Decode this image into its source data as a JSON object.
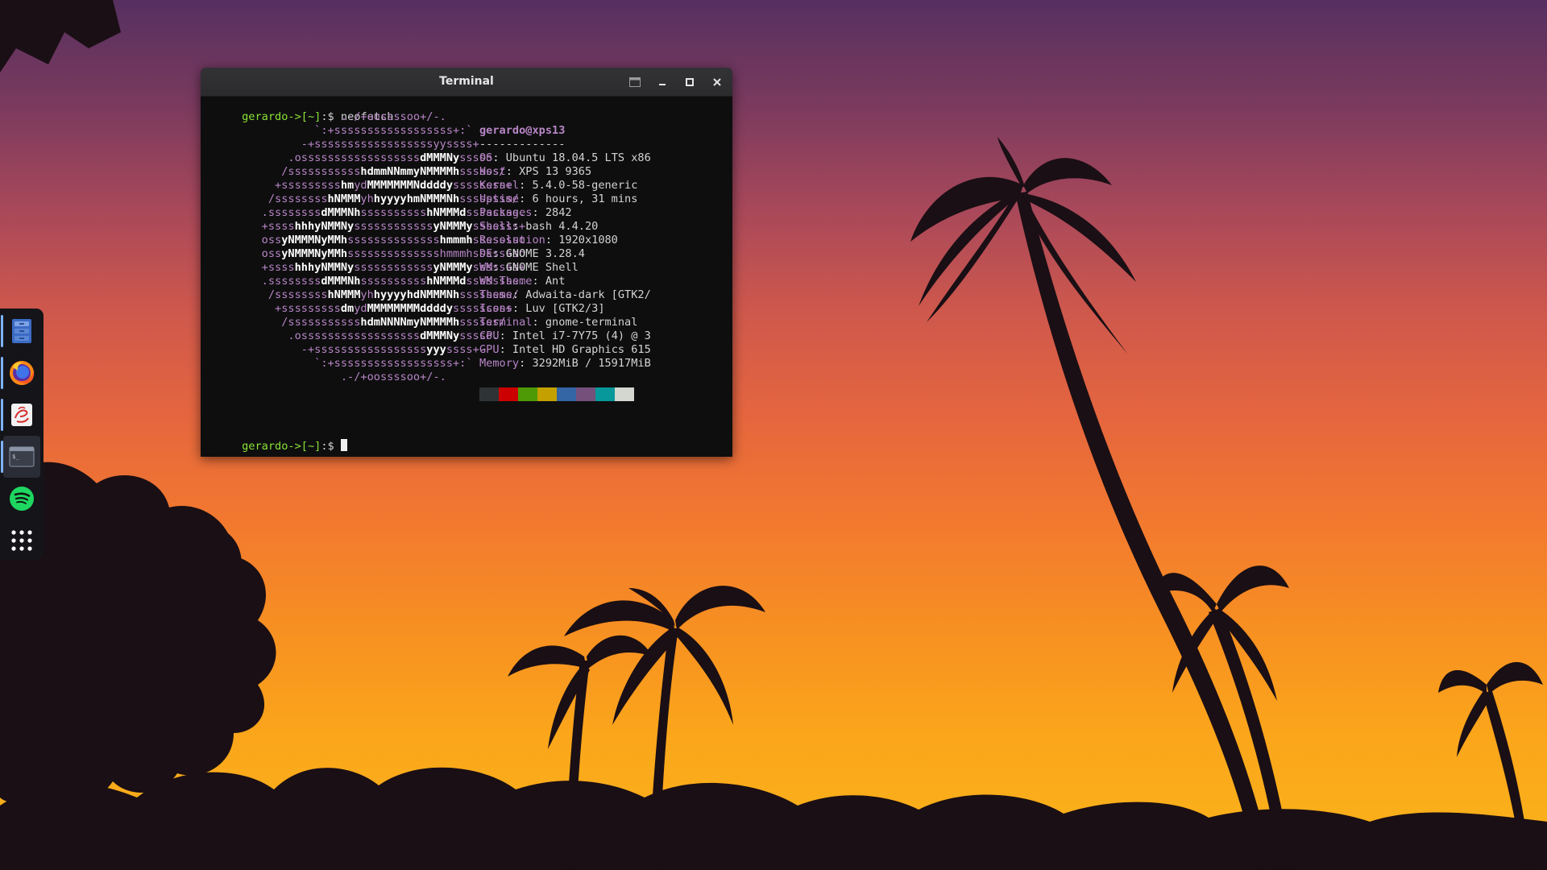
{
  "window": {
    "title": "Terminal"
  },
  "window_buttons": [
    "tab-icon",
    "minimize-icon",
    "maximize-icon",
    "close-icon"
  ],
  "dock": {
    "items": [
      {
        "name": "files-icon"
      },
      {
        "name": "firefox-icon"
      },
      {
        "name": "evince-icon"
      },
      {
        "name": "terminal-icon"
      },
      {
        "name": "spotify-icon"
      },
      {
        "name": "show-apps-icon"
      }
    ]
  },
  "terminal": {
    "prompt_user": "gerardo",
    "prompt_arrow": "->",
    "prompt_dir": "[~]",
    "prompt_symbol": ":$ ",
    "command": "neofetch",
    "ascii_lines": [
      [
        "                     .-/+oossssoo+/-."
      ],
      [
        "                 `:+ssssssssssssssssss+:`"
      ],
      [
        "               -+ssssssssssssssssssyyssss+-"
      ],
      [
        "             .ossssssssssssssssss",
        "dMMMNy",
        "sssso."
      ],
      [
        "            /sssssssssss",
        "hdmmNNmmyNMMMMh",
        "ssssss/"
      ],
      [
        "           +sssssssss",
        "hm",
        "yd",
        "MMMMMMMNddddy",
        "ssssssss+"
      ],
      [
        "          /ssssssss",
        "hNMMM",
        "yh",
        "hyyyyhmNMMMNh",
        "ssssssss/"
      ],
      [
        "         .ssssssss",
        "dMMMNh",
        "ssssssssss",
        "hNMMMd",
        "ssssssss."
      ],
      [
        "         +ssss",
        "hhhyNMMNy",
        "ssssssssssss",
        "yNMMMy",
        "sssssss+"
      ],
      [
        "         oss",
        "yNMMMNyMMh",
        "ssssssssssssss",
        "hmmmh",
        "ssssssso"
      ],
      [
        "         oss",
        "yNMMMNyMMh",
        "sssssssssssssshmmmhssssssso"
      ],
      [
        "         +ssss",
        "hhhyNMMNy",
        "ssssssssssss",
        "yNMMMy",
        "sssssss+"
      ],
      [
        "         .ssssssss",
        "dMMMNh",
        "ssssssssss",
        "hNMMMd",
        "ssssssss."
      ],
      [
        "          /ssssssss",
        "hNMMM",
        "yh",
        "hyyyyhdNMMMNh",
        "ssssssss/"
      ],
      [
        "           +sssssssss",
        "dm",
        "yd",
        "MMMMMMMMddddy",
        "ssssssss+"
      ],
      [
        "            /sssssssssss",
        "hdmNNNNmyNMMMMh",
        "ssssss/"
      ],
      [
        "             .ossssssssssssssssss",
        "dMMMNy",
        "sssso."
      ],
      [
        "               -+sssssssssssssssss",
        "yyy",
        "ssss+-"
      ],
      [
        "                 `:+ssssssssssssssssss+:`"
      ],
      [
        "                     .-/+oossssoo+/-."
      ]
    ],
    "user_host": "gerardo@xps13",
    "separator": "-------------",
    "info": [
      {
        "label": "OS",
        "value": ": Ubuntu 18.04.5 LTS x86"
      },
      {
        "label": "Host",
        "value": ": XPS 13 9365"
      },
      {
        "label": "Kernel",
        "value": ": 5.4.0-58-generic"
      },
      {
        "label": "Uptime",
        "value": ": 6 hours, 31 mins"
      },
      {
        "label": "Packages",
        "value": ": 2842"
      },
      {
        "label": "Shell",
        "value": ": bash 4.4.20"
      },
      {
        "label": "Resolution",
        "value": ": 1920x1080"
      },
      {
        "label": "DE",
        "value": ": GNOME 3.28.4"
      },
      {
        "label": "WM",
        "value": ": GNOME Shell"
      },
      {
        "label": "WM Theme",
        "value": ": Ant"
      },
      {
        "label": "Theme",
        "value": ": Adwaita-dark [GTK2/"
      },
      {
        "label": "Icons",
        "value": ": Luv [GTK2/3]"
      },
      {
        "label": "Terminal",
        "value": ": gnome-terminal"
      },
      {
        "label": "CPU",
        "value": ": Intel i7-7Y75 (4) @ 3"
      },
      {
        "label": "GPU",
        "value": ": Intel HD Graphics 615"
      },
      {
        "label": "Memory",
        "value": ": 3292MiB / 15917MiB"
      }
    ],
    "swatch_colors": [
      "#2e3436",
      "#cc0000",
      "#4e9a06",
      "#c4a000",
      "#3465a4",
      "#75507b",
      "#06989a",
      "#d3d7cf"
    ]
  },
  "colors": {
    "prompt_green": "#8ae234",
    "label_purple": "#b886c6",
    "dock_bg": "#141419",
    "terminal_bg": "#0e0e0f"
  }
}
